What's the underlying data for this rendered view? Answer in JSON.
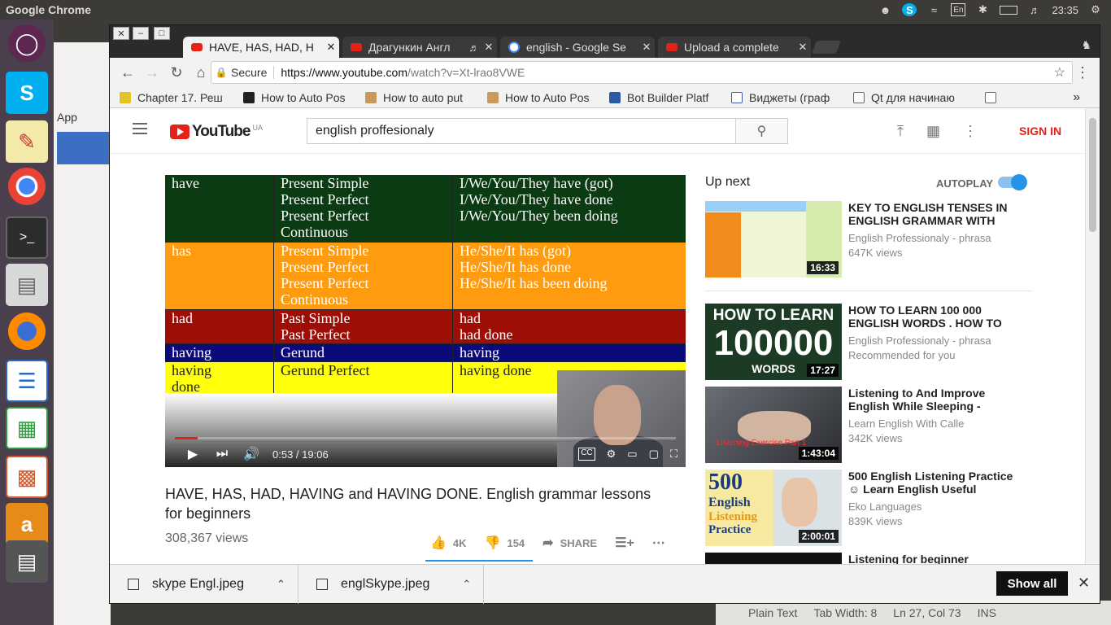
{
  "os": {
    "app_title": "Google Chrome",
    "keyboard_layout": "En",
    "clock": "23:35",
    "gedit_status": {
      "syntax": "Plain Text",
      "tab_width": "Tab Width: 8",
      "position": "Ln 27, Col 73",
      "mode": "INS"
    },
    "bg_apps_label": "App"
  },
  "browser": {
    "tabs": [
      {
        "label": "HAVE, HAS, HAD, H",
        "favicon": "youtube-icon"
      },
      {
        "label": "Драгункин Англ",
        "favicon": "youtube-icon"
      },
      {
        "label": "english - Google Se",
        "favicon": "google-icon"
      },
      {
        "label": "Upload a complete",
        "favicon": "youtube-icon"
      }
    ],
    "secure_label": "Secure",
    "url_prefix": "https://www.youtube.com",
    "url_path": "/watch?v=Xt-lrao8VWE",
    "bookmarks": [
      "Chapter 17. Реш",
      "How to Auto Pos",
      "How to auto put",
      "How to Auto Pos",
      "Bot Builder Platf",
      "Виджеты (граф",
      "Qt для начинаю"
    ],
    "bookmarks_more": "»"
  },
  "youtube": {
    "logo_text": "YouTube",
    "region": "UA",
    "search_value": "english proffesionaly",
    "sign_in": "SIGN IN",
    "player": {
      "table": [
        {
          "c1": "have",
          "c2": "Present Simple\nPresent Perfect\nPresent Perfect\nContinuous",
          "c3": "I/We/You/They have (got)\nI/We/You/They have done\nI/We/You/They been doing"
        },
        {
          "c1": "has",
          "c2": "Present Simple\nPresent Perfect\nPresent Perfect\nContinuous",
          "c3": "He/She/It has (got)\nHe/She/It has done\nHe/She/It has been doing"
        },
        {
          "c1": "had",
          "c2": "Past Simple\nPast Perfect",
          "c3": "had\nhad done"
        },
        {
          "c1": "having",
          "c2": "Gerund",
          "c3": "having"
        },
        {
          "c1": "having\ndone",
          "c2": "Gerund Perfect",
          "c3": "having done"
        }
      ],
      "time": "0:53 / 19:06",
      "progress_fraction": 0.046
    },
    "video_title": "HAVE, HAS, HAD, HAVING and HAVING DONE. English grammar lessons for beginners",
    "views": "308,367 views",
    "likes": "4K",
    "dislikes": "154",
    "share": "SHARE",
    "up_next": "Up next",
    "autoplay": "AUTOPLAY",
    "autoplay_on": true,
    "recommendations": [
      {
        "title": "KEY TO ENGLISH TENSES IN ENGLISH GRAMMAR WITH",
        "channel": "English Professionaly - phrasa",
        "meta": "647K views",
        "duration": "16:33"
      },
      {
        "title": "HOW TO LEARN 100 000 ENGLISH WORDS . HOW TO",
        "channel": "English Professionaly - phrasa",
        "meta": "Recommended for you",
        "duration": "17:27",
        "thumb_line1": "HOW TO LEARN",
        "thumb_line2": "100000",
        "thumb_line3": "WORDS"
      },
      {
        "title": "Listening to And Improve English While Sleeping -",
        "channel": "Learn English With Calle",
        "meta": "342K views",
        "duration": "1:43:04",
        "thumb_text": "Listening Exercise Part 1"
      },
      {
        "title": "500 English Listening Practice ☺ Learn English Useful",
        "channel": "Eko Languages",
        "meta": "839K views",
        "duration": "2:00:01",
        "thumb_line1": "500",
        "thumb_line2": "English",
        "thumb_line3": "Listening",
        "thumb_line4": "Practice"
      },
      {
        "title": "Listening for beginner"
      }
    ]
  },
  "downloads": [
    {
      "name": "skype Engl.jpeg"
    },
    {
      "name": "englSkype.jpeg"
    }
  ],
  "downloads_show_all": "Show all"
}
